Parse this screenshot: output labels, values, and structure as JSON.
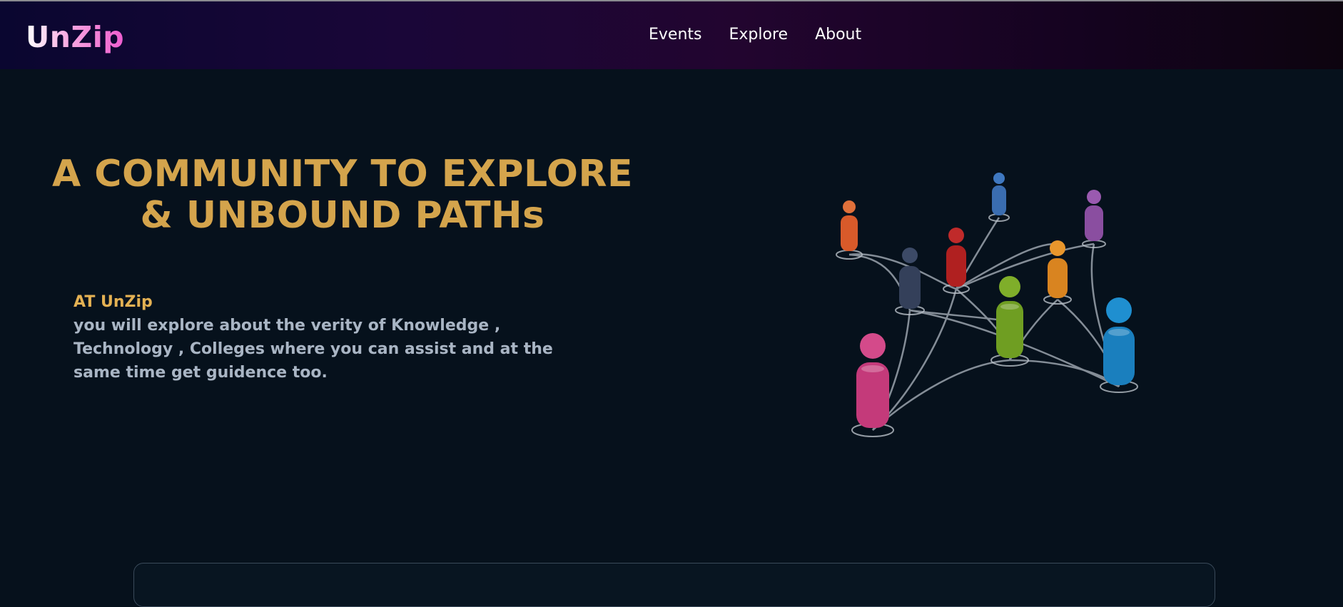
{
  "brand": {
    "logo_text": "UnZip"
  },
  "nav": {
    "items": [
      {
        "label": "Events"
      },
      {
        "label": "Explore"
      },
      {
        "label": "About"
      }
    ]
  },
  "hero": {
    "title_line1": "A COMMUNITY TO EXPLORE",
    "title_line2": "& UNBOUND PATHs",
    "lead": "AT UnZip",
    "body": "you will explore about the verity of Knowledge , Technology , Colleges where you can assist and at the same time get guidence too."
  },
  "illustration": {
    "icon": "people-network-icon",
    "people_colors": [
      "#e0703a",
      "#3f78c0",
      "#9a5ab0",
      "#c02a2a",
      "#3c4a66",
      "#e8962c",
      "#7fae2a",
      "#d44a8a",
      "#1f8fd0"
    ]
  },
  "colors": {
    "accent_gold": "#d4a44c",
    "background": "#06111c",
    "logo_pink": "#ee5ccf"
  }
}
